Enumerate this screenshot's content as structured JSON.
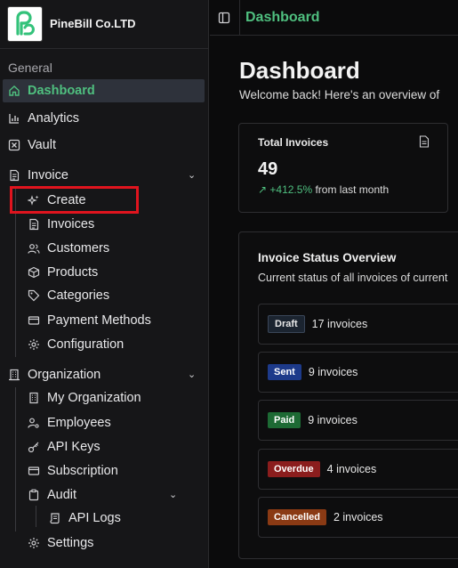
{
  "brand": {
    "name": "PineBill Co.LTD",
    "logo_icon": "pinebill-logo-icon"
  },
  "sidebar": {
    "section_general": "General",
    "items": [
      {
        "label": "Dashboard",
        "icon": "home-icon"
      },
      {
        "label": "Analytics",
        "icon": "bar-chart-icon"
      },
      {
        "label": "Vault",
        "icon": "vault-icon"
      }
    ],
    "invoice": {
      "label": "Invoice",
      "icon": "invoice-icon",
      "children": [
        {
          "label": "Create",
          "icon": "sparkles-icon"
        },
        {
          "label": "Invoices",
          "icon": "file-lines-icon"
        },
        {
          "label": "Customers",
          "icon": "users-icon"
        },
        {
          "label": "Products",
          "icon": "package-icon"
        },
        {
          "label": "Categories",
          "icon": "tag-icon"
        },
        {
          "label": "Payment Methods",
          "icon": "credit-card-icon"
        },
        {
          "label": "Configuration",
          "icon": "gear-icon"
        }
      ]
    },
    "organization": {
      "label": "Organization",
      "icon": "building-icon",
      "children": [
        {
          "label": "My Organization",
          "icon": "building-icon"
        },
        {
          "label": "Employees",
          "icon": "user-cog-icon"
        },
        {
          "label": "API Keys",
          "icon": "key-icon"
        },
        {
          "label": "Subscription",
          "icon": "credit-card-icon"
        },
        {
          "label": "Audit",
          "icon": "clipboard-icon"
        },
        {
          "label": "API Logs",
          "icon": "scroll-icon"
        }
      ]
    },
    "settings": {
      "label": "Settings",
      "icon": "gear-icon"
    }
  },
  "topbar": {
    "title": "Dashboard",
    "toggle_icon": "sidebar-toggle-icon"
  },
  "main": {
    "title": "Dashboard",
    "subtitle": "Welcome back! Here's an overview of",
    "card": {
      "title": "Total Invoices",
      "value": "49",
      "trend_pct": "+412.5%",
      "trend_text": "from last month",
      "icon": "document-icon"
    },
    "status_panel": {
      "title": "Invoice Status Overview",
      "subtitle": "Current status of all invoices of current",
      "rows": [
        {
          "badge": "Draft",
          "count": "17 invoices",
          "color": "#1b2430"
        },
        {
          "badge": "Sent",
          "count": "9 invoices",
          "color": "#1d3a8a"
        },
        {
          "badge": "Paid",
          "count": "9 invoices",
          "color": "#1d6a34"
        },
        {
          "badge": "Overdue",
          "count": "4 invoices",
          "color": "#8b1d1d"
        },
        {
          "badge": "Cancelled",
          "count": "2 invoices",
          "color": "#8a3a14"
        }
      ]
    }
  },
  "colors": {
    "accent": "#4fbf7f",
    "highlight": "#e0141e",
    "sidebar_bg": "#161618",
    "active_bg": "#2e323b"
  }
}
